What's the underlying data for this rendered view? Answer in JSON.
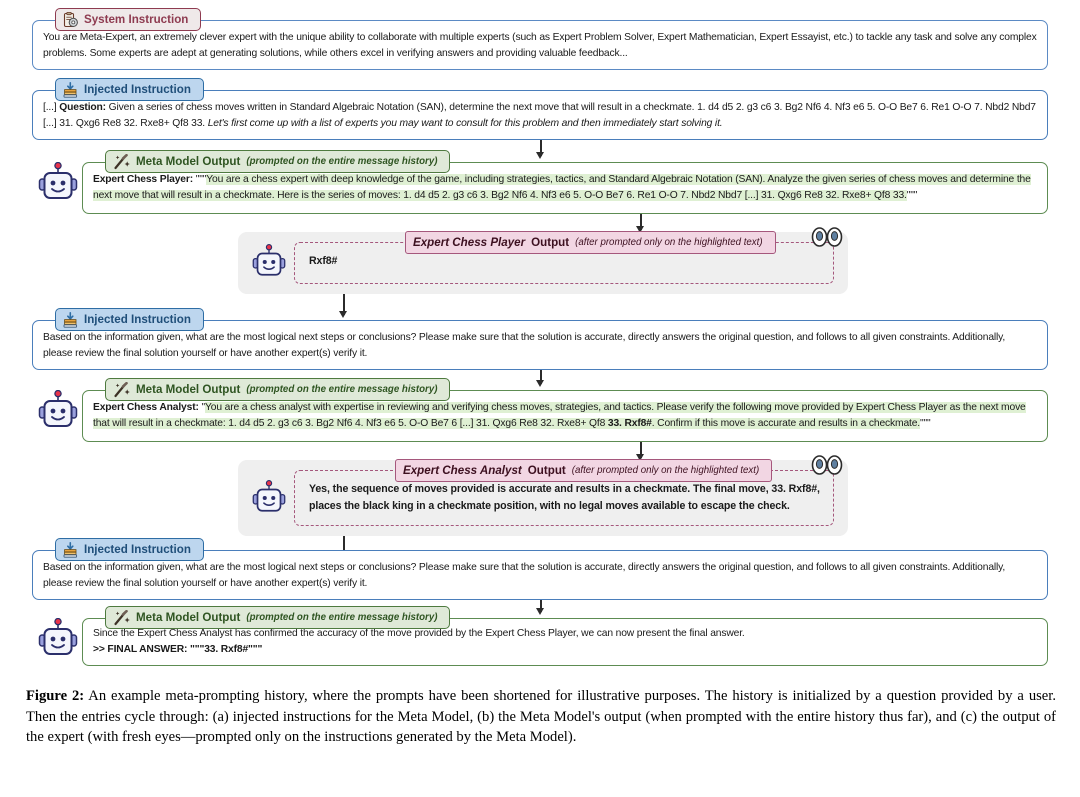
{
  "figure": {
    "label": "Figure 2:",
    "caption": " An example meta-prompting history, where the prompts have been shortened for illustrative purposes. The history is initialized by a question provided by a user. Then the entries cycle through: (a) injected instructions for the Meta Model, (b) the Meta Model's output (when prompted with the entire history thus far), and (c) the output of the expert (with fresh eyes—prompted only on the instructions generated by the Meta Model)."
  },
  "colors": {
    "system_accent": "#8e3b50",
    "injected_accent": "#1f4e79",
    "meta_accent": "#2f5522",
    "expert_accent": "#a5577c",
    "meta_highlight": "#dff0d3",
    "panel_bg": "#efefef"
  },
  "blocks": {
    "system_instruction": {
      "title": "System Instruction",
      "icon": "clipboard-gear-icon",
      "text": "You are Meta-Expert, an extremely clever expert with the unique ability to collaborate with multiple experts (such as Expert Problem Solver, Expert Mathematician, Expert Essayist, etc.) to tackle any task and solve any complex problems. Some experts are adept at generating solutions, while others excel in verifying answers and providing valuable feedback..."
    },
    "injected_instruction_1": {
      "title": "Injected Instruction",
      "icon": "inbox-download-icon",
      "prefix": "[...] ",
      "question_label": "Question:",
      "question_text": " Given a series of chess moves written in Standard Algebraic Notation (SAN), determine the next move that will result in a checkmate. 1. d4 d5 2. g3 c6 3. Bg2 Nf6 4. Nf3 e6 5. O-O Be7 6. Re1 O-O 7. Nbd2 Nbd7 [...] 31. Qxg6 Re8 32. Rxe8+ Qf8 33. ",
      "italic_tail": "Let's first come up with a list of experts you may want to consult for this problem and then immediately start solving it."
    },
    "meta_model_output_1": {
      "title": "Meta Model Output",
      "subtitle": "(prompted on the entire message history)",
      "icon": "magic-wand-icon",
      "speaker": "Expert Chess Player:",
      "quote_open": " \"\"\"",
      "highlighted_text": "You are a chess expert with deep knowledge of the game, including strategies, tactics, and Standard Algebraic Notation (SAN). Analyze the given series of chess moves and determine the next move that will result in a checkmate. Here is the series of moves: 1. d4 d5 2. g3 c6 3. Bg2 Nf6 4. Nf3 e6 5. O-O Be7 6. Re1 O-O 7. Nbd2 Nbd7 [...] 31. Qxg6 Re8 32. Rxe8+ Qf8 33.",
      "quote_close": "\"\"\""
    },
    "expert_output_1": {
      "title_bold": "Expert Chess Player",
      "title_rest": " Output",
      "subtitle": "(after prompted only on the highlighted text)",
      "icon": "robot-icon",
      "eyes_icon": "fresh-eyes-icon",
      "text": "Rxf8#"
    },
    "injected_instruction_2": {
      "title": "Injected Instruction",
      "icon": "inbox-download-icon",
      "text": "Based on the information given, what are the most logical next steps or conclusions? Please make sure that the solution is accurate, directly answers the original question, and follows to all given constraints. Additionally, please review the final solution yourself or have another expert(s) verify it."
    },
    "meta_model_output_2": {
      "title": "Meta Model Output",
      "subtitle": "(prompted on the entire message history)",
      "icon": "magic-wand-icon",
      "speaker": "Expert Chess Analyst:",
      "quote_open": " \"",
      "highlighted_text_part1": "You are a chess analyst with expertise in reviewing and verifying chess moves, strategies, and tactics. Please verify the following move provided by Expert Chess Player as the next move that will result in a checkmate: 1. d4 d5 2. g3 c6 3. Bg2 Nf6 4. Nf3 e6 5. O-O Be7 6 [...] 31. Qxg6 Re8 32. Rxe8+ Qf8 ",
      "highlighted_bold": "33. Rxf8#",
      "highlighted_text_part2": ". Confirm if this move is accurate and results in a checkmate.",
      "quote_close": "\"\"\""
    },
    "expert_output_2": {
      "title_bold": "Expert Chess Analyst",
      "title_rest": " Output",
      "subtitle": "(after prompted only on the highlighted text)",
      "icon": "robot-icon",
      "eyes_icon": "fresh-eyes-icon",
      "text": "Yes, the sequence of moves provided is accurate and results in a checkmate. The final move, 33. Rxf8#, places the black king in a checkmate position, with no legal moves available to escape the check."
    },
    "injected_instruction_3": {
      "title": "Injected Instruction",
      "icon": "inbox-download-icon",
      "text": "Based on the information given, what are the most logical next steps or conclusions? Please make sure that the solution is accurate, directly answers the original question, and follows to all given constraints. Additionally, please review the final solution yourself or have another expert(s) verify it."
    },
    "meta_model_output_3": {
      "title": "Meta Model Output",
      "subtitle": "(prompted on the entire message history)",
      "icon": "magic-wand-icon",
      "line1": "Since the Expert Chess Analyst has confirmed the accuracy of the move provided by the Expert Chess Player, we can now present the final answer.",
      "line2": ">> FINAL ANSWER: \"\"\"33. Rxf8#\"\"\""
    }
  }
}
